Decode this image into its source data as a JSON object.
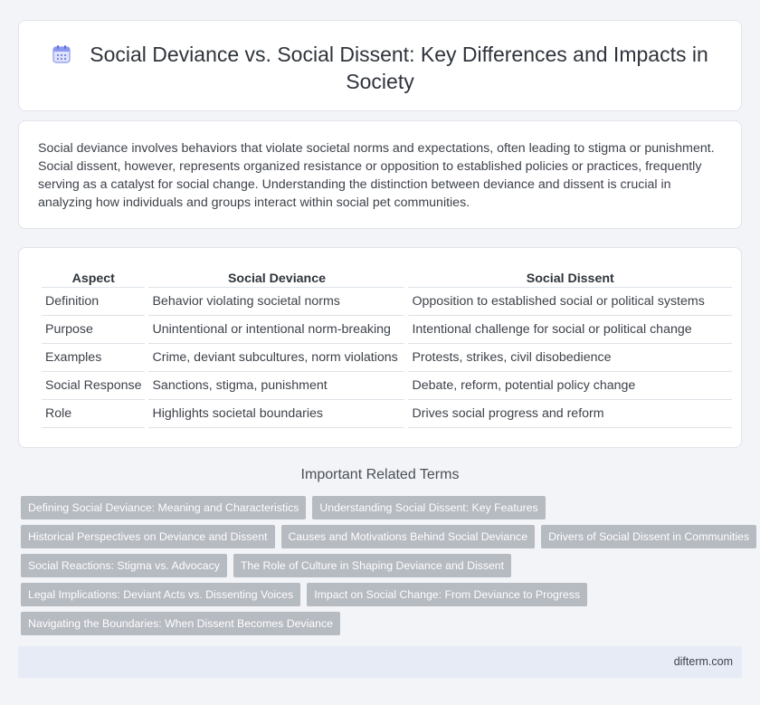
{
  "header": {
    "title": "Social Deviance vs. Social Dissent: Key Differences and Impacts in Society",
    "icon": "calendar-icon"
  },
  "intro": {
    "text": "Social deviance involves behaviors that violate societal norms and expectations, often leading to stigma or punishment. Social dissent, however, represents organized resistance or opposition to established policies or practices, frequently serving as a catalyst for social change. Understanding the distinction between deviance and dissent is crucial in analyzing how individuals and groups interact within social pet communities."
  },
  "comparison": {
    "headers": [
      "Aspect",
      "Social Deviance",
      "Social Dissent"
    ],
    "rows": [
      [
        "Definition",
        "Behavior violating societal norms",
        "Opposition to established social or political systems"
      ],
      [
        "Purpose",
        "Unintentional or intentional norm-breaking",
        "Intentional challenge for social or political change"
      ],
      [
        "Examples",
        "Crime, deviant subcultures, norm violations",
        "Protests, strikes, civil disobedience"
      ],
      [
        "Social Response",
        "Sanctions, stigma, punishment",
        "Debate, reform, potential policy change"
      ],
      [
        "Role",
        "Highlights societal boundaries",
        "Drives social progress and reform"
      ]
    ]
  },
  "related": {
    "title": "Important Related Terms",
    "tags": [
      [
        "Defining Social Deviance: Meaning and Characteristics",
        "Understanding Social Dissent: Key Features"
      ],
      [
        "Historical Perspectives on Deviance and Dissent",
        "Causes and Motivations Behind Social Deviance",
        "Drivers of Social Dissent in Communities"
      ],
      [
        "Social Reactions: Stigma vs. Advocacy",
        "The Role of Culture in Shaping Deviance and Dissent"
      ],
      [
        "Legal Implications: Deviant Acts vs. Dissenting Voices",
        "Impact on Social Change: From Deviance to Progress"
      ],
      [
        "Navigating the Boundaries: When Dissent Becomes Deviance"
      ]
    ]
  },
  "footer": {
    "site": "difterm.com"
  },
  "colors": {
    "tag_bg": "#b6bac1",
    "footer_bg": "#e6ebf6",
    "icon_accent": "#7b8cf0"
  }
}
